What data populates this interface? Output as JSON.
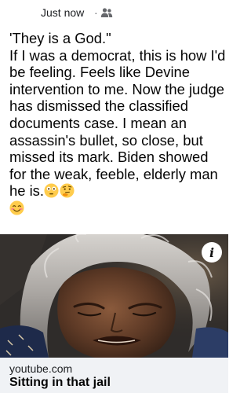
{
  "post": {
    "timestamp": "Just now",
    "separator": "·",
    "audience_icon": "friends-icon",
    "text_lines": [
      "'They is a God.\"",
      "If I was a democrat, this is how I'd be feeling. Feels like Devine intervention to me. Now the judge has dismissed the classified documents case. I mean an assassin's bullet, so close, but missed its mark. Biden showed for the weak, feeble, elderly man he is."
    ],
    "emojis": [
      "flushed-face-icon",
      "thinking-face-icon",
      "smiling-face-icon"
    ]
  },
  "media": {
    "info_label": "i",
    "image_icon": "video-thumbnail-crying-woman"
  },
  "link_preview": {
    "domain": "youtube.com",
    "title": "Sitting in that jail"
  }
}
